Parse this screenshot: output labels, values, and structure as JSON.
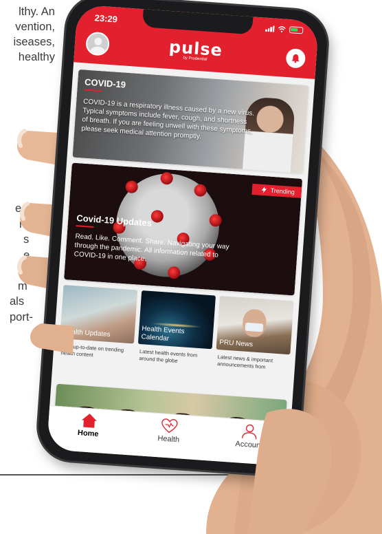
{
  "document": {
    "top_lines": [
      "lthy.  An",
      "vention,",
      "iseases,",
      "healthy"
    ],
    "middle_lines": [
      "er",
      "m-",
      "s",
      "e",
      "e-",
      "m",
      "als",
      "port-"
    ]
  },
  "status_bar": {
    "time": "23:29"
  },
  "header": {
    "logo": "pulse",
    "logo_sub": "by Prudential"
  },
  "covid_card": {
    "title": "COVID-19",
    "body": "COVID-19 is a respiratory illness caused by a new virus. Typical symptoms include fever, cough, and shortness of breath. If you are feeling unwell with these symptoms, please seek medical attention promptly."
  },
  "updates_card": {
    "badge": "Trending",
    "title": "Covid-19 Updates",
    "body": "Read. Like. Comment. Share. Navigating your way through the pandemic. All information related to COVID-19 in one place."
  },
  "tiles": [
    {
      "label": "Health Updates",
      "desc": "Stay up-to-date on trending health content"
    },
    {
      "label": "Health Events Calendar",
      "desc": "Latest health events from around the globe"
    },
    {
      "label": "PRU News",
      "desc": "Latest news & important announcements from"
    }
  ],
  "tabs": [
    {
      "label": "Home",
      "icon": "home-icon",
      "active": true
    },
    {
      "label": "Health",
      "icon": "heart-icon",
      "active": false
    },
    {
      "label": "Account",
      "icon": "person-icon",
      "active": false
    }
  ],
  "colors": {
    "brand_red": "#e2202e"
  }
}
